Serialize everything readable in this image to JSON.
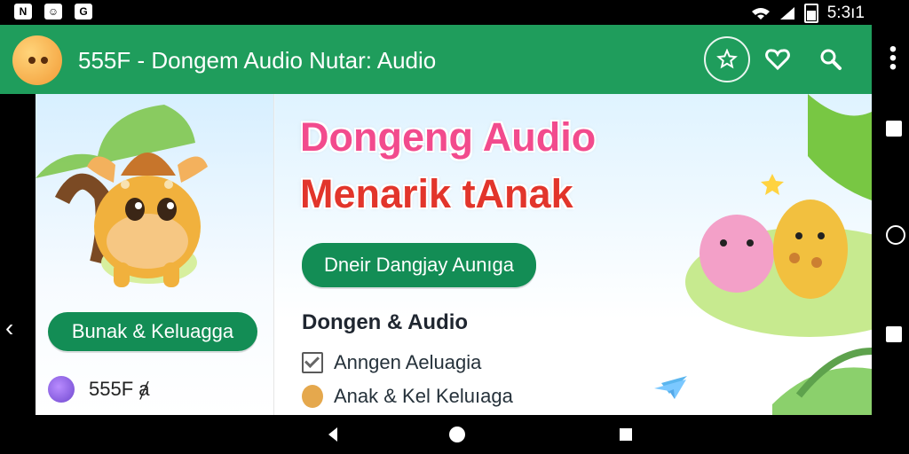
{
  "status_bar": {
    "time": "5:3ı1",
    "left_icons": [
      "notification-icon-1",
      "notification-icon-2",
      "notification-icon-3"
    ],
    "left_icon_labels": [
      "N",
      "☺",
      "G"
    ]
  },
  "app_bar": {
    "title": "555F - Dongem Audio Nutar:  Audio",
    "buttons": [
      "star-icon",
      "heart-icon",
      "search-icon"
    ]
  },
  "content": {
    "left_button": "Bunak & Keluagga",
    "left_small_text": "555F ⱥ",
    "headline_line1": "Dongeng Audio",
    "headline_line2": "Menarik tAnak",
    "download_button": "Dneir Dangjay Aunıga",
    "section_title": "Dongen & Audio",
    "checkbox_label": "Anngen Aeluagia",
    "list_item": "Anak & Kel Keluıaga"
  },
  "colors": {
    "app_bar": "#1f9d5c",
    "button_green": "#138d55",
    "status_bar": "#000000",
    "headline_pink": "#f24b8d",
    "headline_red": "#e2352b"
  }
}
